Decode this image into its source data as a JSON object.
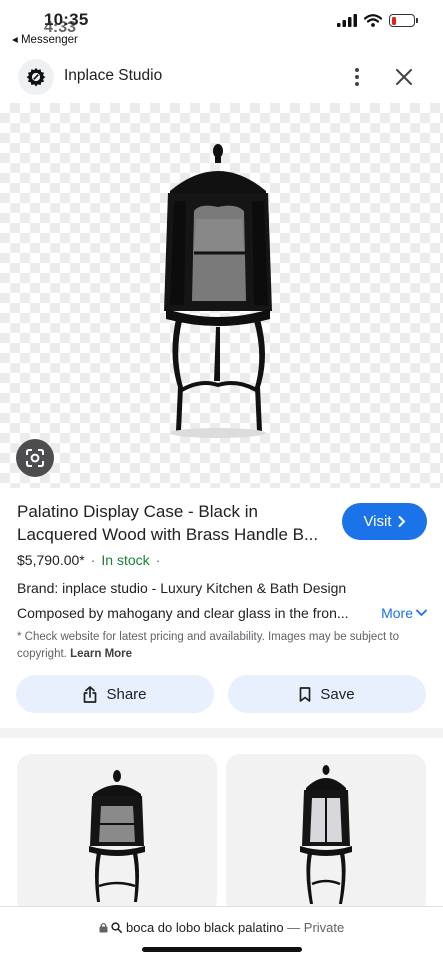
{
  "status_bar": {
    "time": "10:35",
    "time_overlay": "4:33",
    "back_app": "◂ Messenger",
    "battery_color": "#e0241b",
    "battery_level": 0.2
  },
  "header": {
    "site_name": "Inplace Studio",
    "more_icon": "more-vert-icon",
    "close_icon": "close-icon"
  },
  "product": {
    "title": "Palatino Display Case - Black in Lacquered Wood with Brass Handle B...",
    "price": "$5,790.00*",
    "stock": "In stock",
    "separator": "·",
    "brand": "Brand: inplace studio - Luxury Kitchen & Bath Design",
    "description": "Composed by mahogany and clear glass in the fron...",
    "more_label": "More",
    "disclaimer": "* Check website for latest pricing and availability. Images may be subject to copyright.",
    "learn_more": "Learn More"
  },
  "visit_button": {
    "label": "Visit",
    "color": "#1a73e8"
  },
  "actions": {
    "share_label": "Share",
    "save_label": "Save"
  },
  "url_bar": {
    "query": "boca do lobo black  palatino",
    "dash": "—",
    "private_label": "Private"
  }
}
